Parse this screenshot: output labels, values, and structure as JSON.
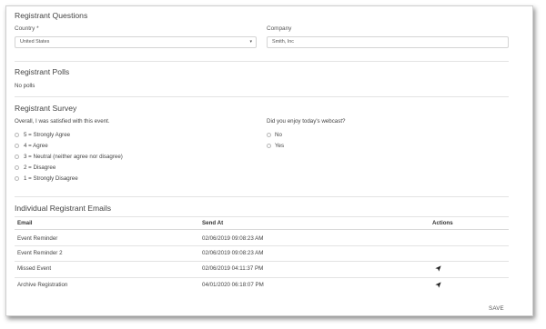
{
  "questions": {
    "title": "Registrant Questions",
    "country_label": "Country *",
    "country_value": "United States",
    "company_label": "Company",
    "company_value": "Smith, Inc"
  },
  "polls": {
    "title": "Registrant Polls",
    "empty_text": "No polls"
  },
  "survey": {
    "title": "Registrant Survey",
    "q1": "Overall, I was satisfied with this event.",
    "q1_options": [
      "5 = Strongly Agree",
      "4 = Agree",
      "3 = Neutral (neither agree nor disagree)",
      "2 = Disagree",
      "1 = Strongly Disagree"
    ],
    "q2": "Did you enjoy today's webcast?",
    "q2_options": [
      "No",
      "Yes"
    ]
  },
  "emails": {
    "title": "Individual Registrant Emails",
    "columns": [
      "Email",
      "Send At",
      "Actions"
    ],
    "rows": [
      {
        "email": "Event Reminder",
        "send_at": "02/06/2019 09:08:23 AM"
      },
      {
        "email": "Event Reminder 2",
        "send_at": "02/06/2019 09:08:23 AM"
      },
      {
        "email": "Missed Event",
        "send_at": "02/06/2019 04:11:37 PM"
      },
      {
        "email": "Archive Registration",
        "send_at": "04/01/2020 06:18:07 PM"
      }
    ]
  },
  "save_label": "SAVE",
  "icons": {
    "send": "paper-plane-icon",
    "dropdown": "caret-down-icon"
  },
  "colors": {
    "text": "#333333",
    "border": "#d4d4d4",
    "divider": "#e3e3e3"
  }
}
